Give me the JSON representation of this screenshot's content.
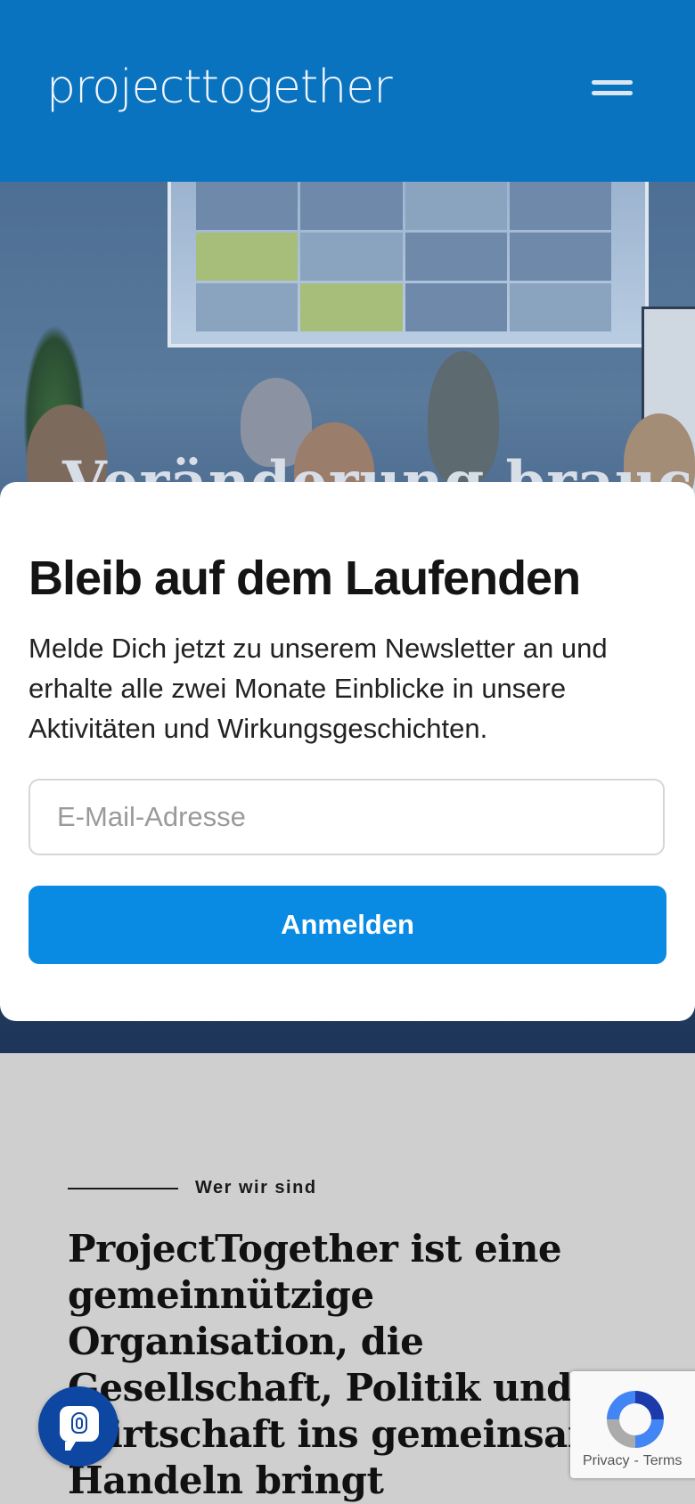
{
  "header": {
    "logo_text": "projecttogether",
    "menu_icon": "hamburger-menu-icon"
  },
  "hero": {
    "title": "Veränderung braucht"
  },
  "newsletter_modal": {
    "title": "Bleib auf dem Laufenden",
    "text": "Melde Dich jetzt zu unserem Newsletter an und erhalte alle zwei Monate Einblicke in unsere Aktivitäten und Wirkungsgeschichten.",
    "email_placeholder": "E-Mail-Adresse",
    "email_value": "",
    "submit_label": "Anmelden"
  },
  "about": {
    "eyebrow": "Wer wir sind",
    "title": "ProjectTogether ist eine gemeinnützige Organisation, die Gesellschaft, Politik und Wirtschaft ins gemeinsame Handeln bringt"
  },
  "chat_widget": {
    "icon": "fingerprint-chat-icon"
  },
  "recaptcha": {
    "privacy_label": "Privacy",
    "separator": "-",
    "terms_label": "Terms"
  },
  "colors": {
    "header_bg": "#0a73bf",
    "button_bg": "#0a8be3",
    "chat_bg": "#0d47a1",
    "section_bg": "#cfcfcf"
  }
}
